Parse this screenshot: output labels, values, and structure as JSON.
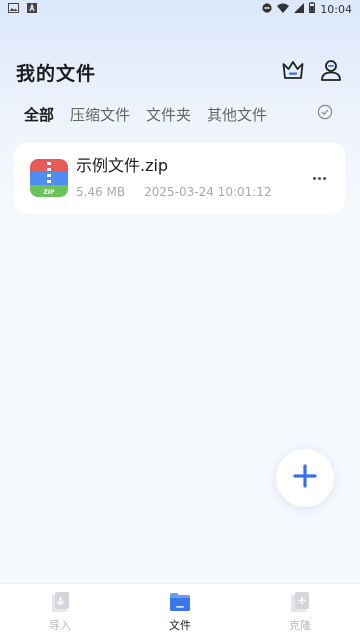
{
  "status_bar": {
    "time": "10:04",
    "left_icons": [
      "image-icon",
      "a-icon"
    ],
    "right_icons": [
      "do-not-disturb-icon",
      "wifi-icon",
      "signal-icon",
      "battery-icon"
    ]
  },
  "header": {
    "title": "我的文件",
    "actions": [
      "crown-icon",
      "user-icon"
    ]
  },
  "tabs": [
    {
      "label": "全部",
      "active": true
    },
    {
      "label": "压缩文件",
      "active": false
    },
    {
      "label": "文件夹",
      "active": false
    },
    {
      "label": "其他文件",
      "active": false
    }
  ],
  "files": [
    {
      "name": "示例文件.zip",
      "size": "5.46 MB",
      "date": "2025-03-24 10:01:12",
      "icon": "zip-file-icon"
    }
  ],
  "fab": {
    "icon": "plus-icon"
  },
  "bottom_nav": [
    {
      "label": "导入",
      "icon": "import-icon",
      "active": false
    },
    {
      "label": "文件",
      "icon": "folder-icon",
      "active": true
    },
    {
      "label": "克隆",
      "icon": "clone-icon",
      "active": false
    }
  ],
  "colors": {
    "accent": "#3a6fe0",
    "zip_red": "#e65b57",
    "zip_blue": "#4d8ef2",
    "zip_green": "#6bc45a"
  }
}
